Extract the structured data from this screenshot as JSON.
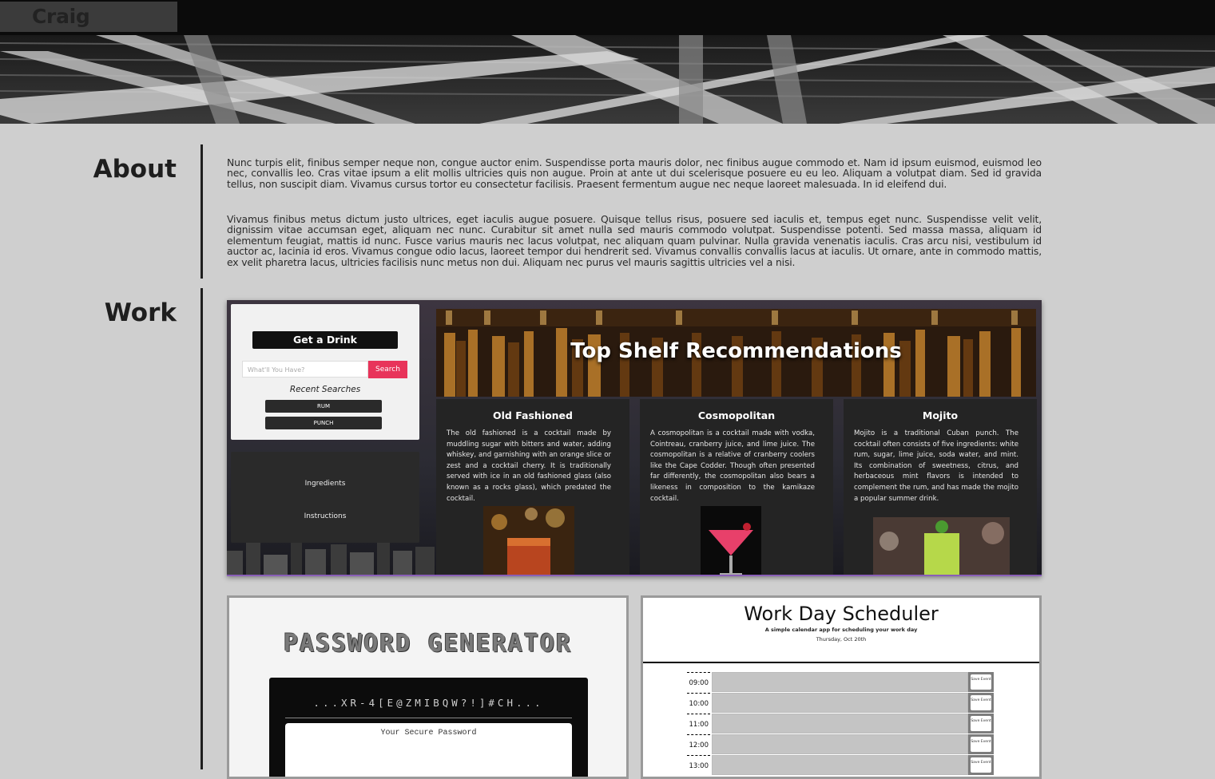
{
  "header": {
    "brand": "Craig Putzstuck"
  },
  "about": {
    "heading": "About",
    "paragraphs": [
      "Nunc turpis elit, finibus semper neque non, congue auctor enim. Suspendisse porta mauris dolor, nec finibus augue commodo et. Nam id ipsum euismod, euismod leo nec, convallis leo. Cras vitae ipsum a elit mollis ultricies quis non augue. Proin at ante ut dui scelerisque posuere eu eu leo. Aliquam a volutpat diam. Sed id gravida tellus, non suscipit diam. Vivamus cursus tortor eu consectetur facilisis. Praesent fermentum augue nec neque laoreet malesuada. In id eleifend dui.",
      "Vivamus finibus metus dictum justo ultrices, eget iaculis augue posuere. Quisque tellus risus, posuere sed iaculis et, tempus eget nunc. Suspendisse velit velit, dignissim vitae accumsan eget, aliquam nec nunc. Curabitur sit amet nulla sed mauris commodo volutpat. Suspendisse potenti. Sed massa massa, aliquam id elementum feugiat, mattis id nunc. Fusce varius mauris nec lacus volutpat, nec aliquam quam pulvinar. Nulla gravida venenatis iaculis. Cras arcu nisi, vestibulum id auctor ac, lacinia id eros. Vivamus congue odio lacus, laoreet tempor dui hendrerit sed. Vivamus convallis convallis lacus at iaculis. Ut ornare, ante in commodo mattis, ex velit pharetra lacus, ultricies facilisis nunc metus non dui. Aliquam nec purus vel mauris sagittis ultricies vel a nisi."
    ]
  },
  "work": {
    "heading": "Work",
    "drink_app": {
      "get_drink_label": "Get a Drink",
      "search_placeholder": "What'll You Have?",
      "search_button": "Search",
      "recent_title": "Recent Searches",
      "recent": [
        "RUM",
        "PUNCH"
      ],
      "side_items": [
        "Ingredients",
        "Instructions"
      ],
      "banner_title": "Top Shelf Recommendations",
      "drinks": [
        {
          "name": "Old Fashioned",
          "desc": "The old fashioned is a cocktail made by muddling sugar with bitters and water, adding whiskey, and garnishing with an orange slice or zest and a cocktail cherry. It is traditionally served with ice in an old fashioned glass (also known as a rocks glass), which predated the cocktail."
        },
        {
          "name": "Cosmopolitan",
          "desc": "A cosmopolitan is a cocktail made with vodka, Cointreau, cranberry juice, and lime juice. The cosmopolitan is a relative of cranberry coolers like the Cape Codder. Though often presented far differently, the cosmopolitan also bears a likeness in composition to the kamikaze cocktail."
        },
        {
          "name": "Mojito",
          "desc": "Mojito is a traditional Cuban punch. The cocktail often consists of five ingredients: white rum, sugar, lime juice, soda water, and mint. Its combination of sweetness, citrus, and herbaceous mint flavors is intended to complement the rum, and has made the mojito a popular summer drink."
        }
      ]
    },
    "password_app": {
      "title": "PASSWORD GENERATOR",
      "code_preview": "...XR-4[E@ZMIBQW?!]#CH...",
      "output_label": "Your Secure Password"
    },
    "scheduler_app": {
      "title": "Work Day Scheduler",
      "subtitle": "A simple calendar app for scheduling your work day",
      "date": "Thursday, Oct 20th",
      "hours": [
        "09:00",
        "10:00",
        "11:00",
        "12:00",
        "13:00"
      ],
      "save_label": "Save Event"
    }
  }
}
